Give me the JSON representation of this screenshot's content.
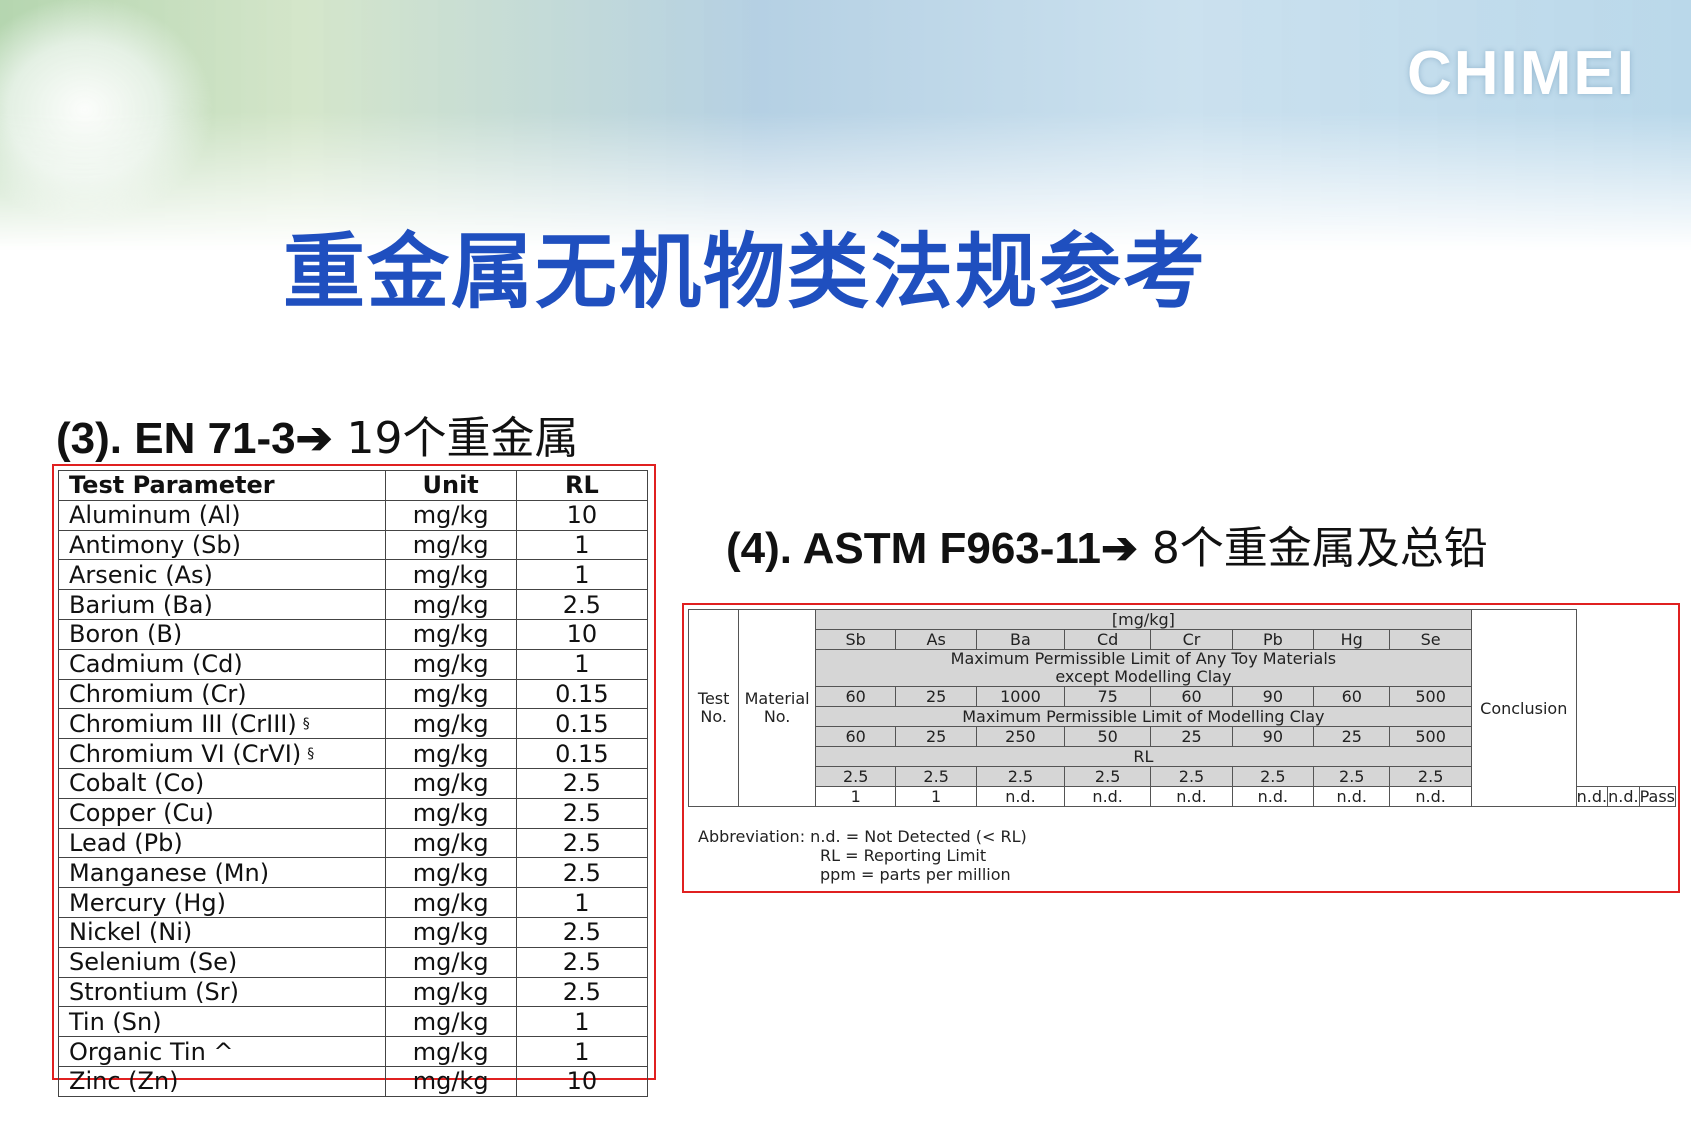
{
  "logo": "CHIMEI",
  "title": "重金属无机物类法规参考",
  "en71": {
    "heading_bold": "(3). EN 71-3",
    "heading_rest": "19个重金属",
    "arrow": "➔",
    "headers": [
      "Test Parameter",
      "Unit",
      "RL"
    ],
    "rows": [
      {
        "param": "Aluminum (Al)",
        "unit": "mg/kg",
        "rl": "10",
        "mark": ""
      },
      {
        "param": "Antimony (Sb)",
        "unit": "mg/kg",
        "rl": "1",
        "mark": ""
      },
      {
        "param": "Arsenic (As)",
        "unit": "mg/kg",
        "rl": "1",
        "mark": ""
      },
      {
        "param": "Barium (Ba)",
        "unit": "mg/kg",
        "rl": "2.5",
        "mark": ""
      },
      {
        "param": "Boron (B)",
        "unit": "mg/kg",
        "rl": "10",
        "mark": ""
      },
      {
        "param": "Cadmium (Cd)",
        "unit": "mg/kg",
        "rl": "1",
        "mark": ""
      },
      {
        "param": "Chromium (Cr)",
        "unit": "mg/kg",
        "rl": "0.15",
        "mark": ""
      },
      {
        "param": "Chromium III (CrIII)",
        "unit": "mg/kg",
        "rl": "0.15",
        "mark": "§"
      },
      {
        "param": "Chromium VI (CrVI)",
        "unit": "mg/kg",
        "rl": "0.15",
        "mark": "§"
      },
      {
        "param": "Cobalt (Co)",
        "unit": "mg/kg",
        "rl": "2.5",
        "mark": ""
      },
      {
        "param": "Copper (Cu)",
        "unit": "mg/kg",
        "rl": "2.5",
        "mark": ""
      },
      {
        "param": "Lead (Pb)",
        "unit": "mg/kg",
        "rl": "2.5",
        "mark": ""
      },
      {
        "param": "Manganese (Mn)",
        "unit": "mg/kg",
        "rl": "2.5",
        "mark": ""
      },
      {
        "param": "Mercury (Hg)",
        "unit": "mg/kg",
        "rl": "1",
        "mark": ""
      },
      {
        "param": "Nickel (Ni)",
        "unit": "mg/kg",
        "rl": "2.5",
        "mark": ""
      },
      {
        "param": "Selenium (Se)",
        "unit": "mg/kg",
        "rl": "2.5",
        "mark": ""
      },
      {
        "param": "Strontium (Sr)",
        "unit": "mg/kg",
        "rl": "2.5",
        "mark": ""
      },
      {
        "param": "Tin (Sn)",
        "unit": "mg/kg",
        "rl": "1",
        "mark": ""
      },
      {
        "param": "Organic Tin ^",
        "unit": "mg/kg",
        "rl": "1",
        "mark": ""
      },
      {
        "param": "Zinc (Zn)",
        "unit": "mg/kg",
        "rl": "10",
        "mark": ""
      }
    ]
  },
  "astm": {
    "heading_bold": "(4). ASTM F963-11",
    "heading_rest": "8个重金属及总铅",
    "arrow": "➔",
    "unit": "[mg/kg]",
    "test_no": [
      "Test",
      "No."
    ],
    "material_no": [
      "Material",
      "No."
    ],
    "conclusion_label": "Conclusion",
    "elements": [
      "Sb",
      "As",
      "Ba",
      "Cd",
      "Cr",
      "Pb",
      "Hg",
      "Se"
    ],
    "limit_any_label": [
      "Maximum Permissible Limit of Any Toy Materials",
      "except Modelling Clay"
    ],
    "limit_any": [
      "60",
      "25",
      "1000",
      "75",
      "60",
      "90",
      "60",
      "500"
    ],
    "limit_clay_label": "Maximum Permissible Limit of Modelling Clay",
    "limit_clay": [
      "60",
      "25",
      "250",
      "50",
      "25",
      "90",
      "25",
      "500"
    ],
    "rl_label": "RL",
    "rl": [
      "2.5",
      "2.5",
      "2.5",
      "2.5",
      "2.5",
      "2.5",
      "2.5",
      "2.5"
    ],
    "result": {
      "test": "1",
      "material": "1",
      "values": [
        "n.d.",
        "n.d.",
        "n.d.",
        "n.d.",
        "n.d.",
        "n.d.",
        "n.d.",
        "n.d."
      ],
      "conclusion": "Pass"
    },
    "abbreviation": [
      "Abbreviation: n.d. = Not Detected (< RL)",
      "RL = Reporting Limit",
      "ppm = parts per million"
    ]
  }
}
